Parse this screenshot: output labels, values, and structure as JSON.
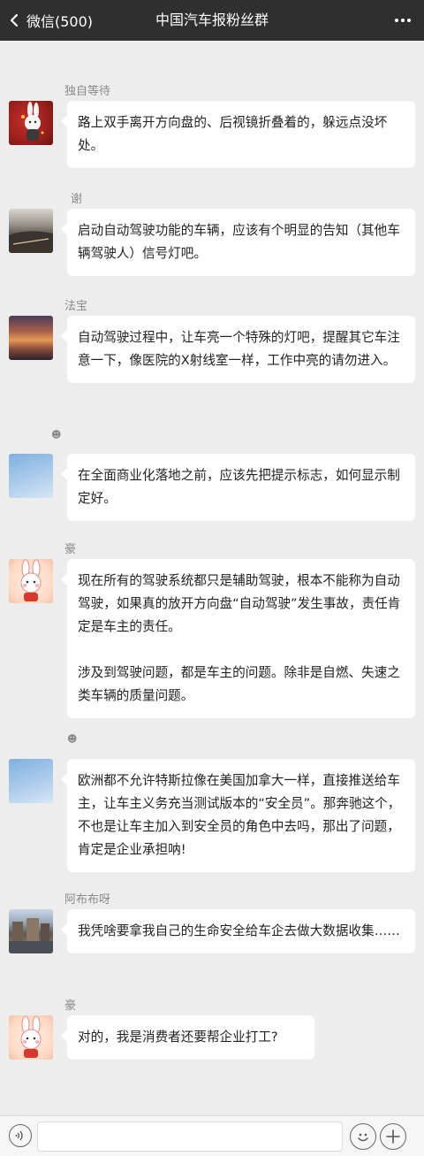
{
  "header": {
    "back_label": "微信(500)",
    "title": "中国汽车报粉丝群"
  },
  "messages": [
    {
      "sender": "独自等待",
      "avatar_icon": "rabbit-on-red-avatar",
      "text": "路上双手离开方向盘的、后视镜折叠着的，躲远点没坏处。"
    },
    {
      "sender": "谢",
      "avatar_icon": "road-photo-avatar",
      "text": "启动自动驾驶功能的车辆，应该有个明显的告知（其他车辆驾驶人）信号灯吧。"
    },
    {
      "sender": "法宝",
      "avatar_icon": "sunset-photo-avatar",
      "text": "自动驾驶过程中，让车亮一个特殊的灯吧，提醒其它车注意一下，像医院的X射线室一样，工作中亮的请勿进入。"
    },
    {
      "sender": "☻",
      "avatar_icon": "blue-sky-avatar",
      "text": "在全面商业化落地之前，应该先把提示标志，如何显示制定好。"
    },
    {
      "sender": "豪",
      "avatar_icon": "cartoon-rabbit-avatar",
      "text": "现在所有的驾驶系统都只是辅助驾驶，根本不能称为自动驾驶，如果真的放开方向盘“自动驾驶”发生事故，责任肯定是车主的责任。\n\n涉及到驾驶问题，都是车主的问题。除非是自燃、失速之类车辆的质量问题。"
    },
    {
      "sender": "☻",
      "avatar_icon": "blue-sky-avatar",
      "text": "欧洲都不允许特斯拉像在美国加拿大一样，直接推送给车主，让车主义务充当测试版本的“安全员”。那奔驰这个，不也是让车主加入到安全员的角色中去吗，那出了问题，肯定是企业承担呐!"
    },
    {
      "sender": "阿布布呀",
      "avatar_icon": "town-street-avatar",
      "text": "我凭啥要拿我自己的生命安全给车企去做大数据收集……"
    },
    {
      "sender": "豪",
      "avatar_icon": "cartoon-rabbit-avatar",
      "text": "对的，我是消费者还要帮企业打工?"
    }
  ],
  "input_bar": {
    "placeholder": ""
  }
}
